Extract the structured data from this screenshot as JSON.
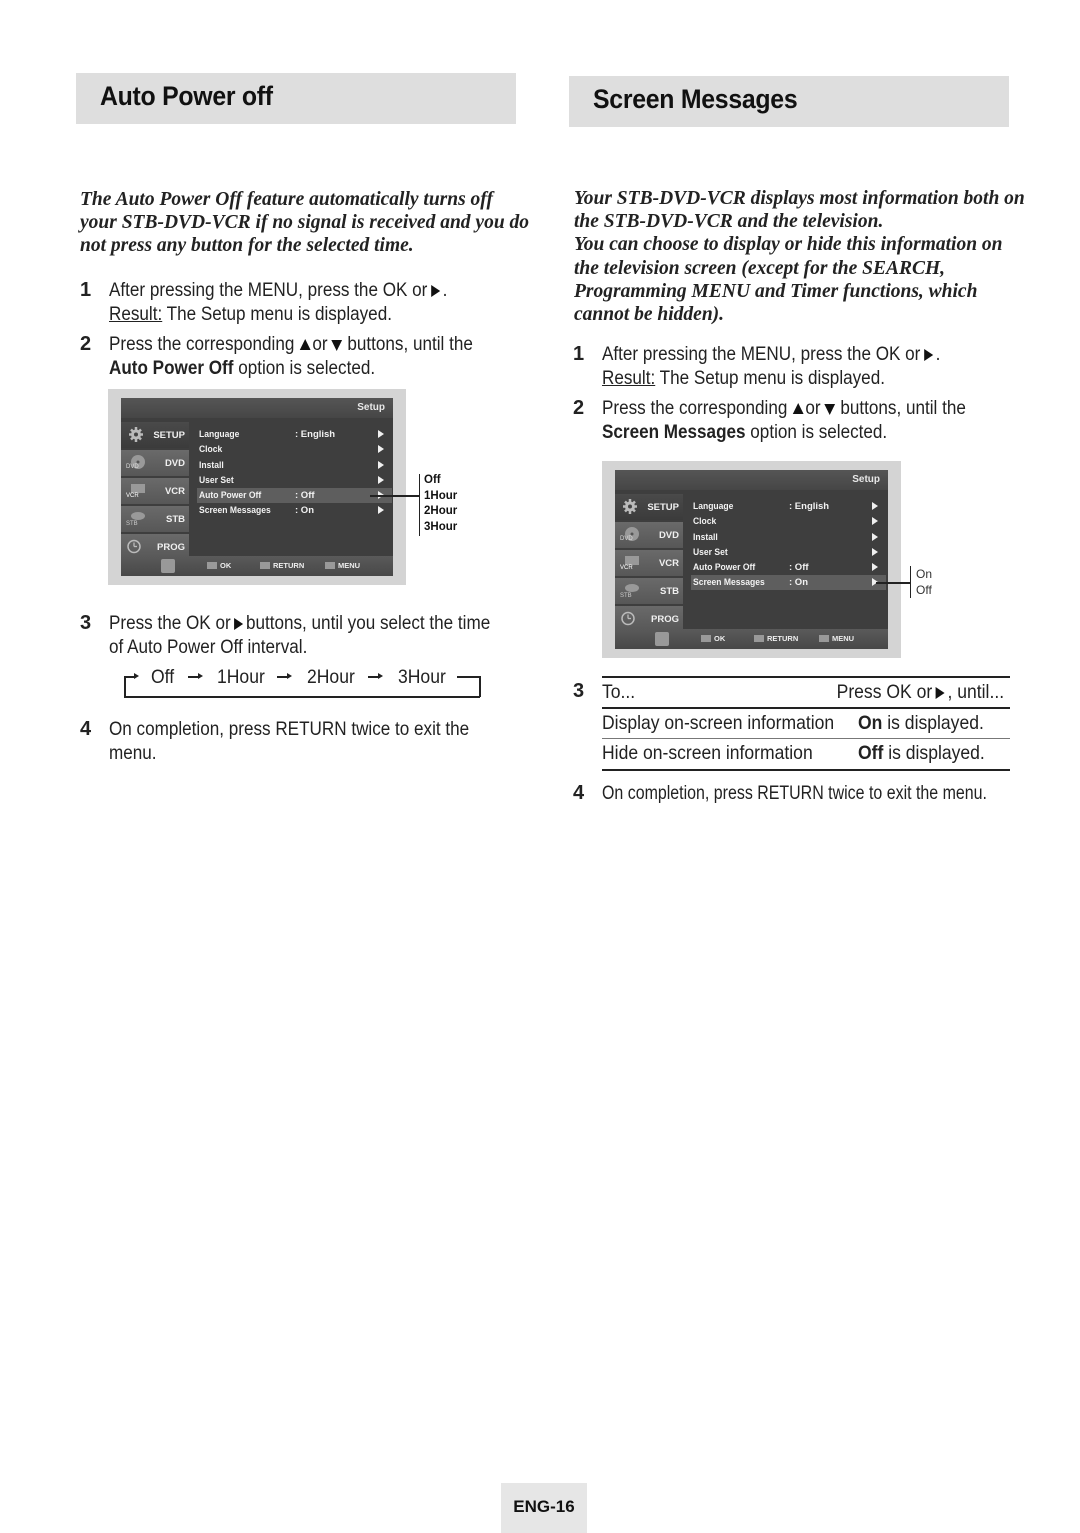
{
  "left": {
    "title": "Auto Power off",
    "intro": [
      "The Auto Power Off feature automatically turns off",
      "your STB-DVD-VCR if no signal is received and you do",
      "not press any button for the selected time."
    ],
    "steps": {
      "s1": {
        "num": "1",
        "line1": "After pressing the MENU, press the OK or",
        "line1_end": ".",
        "result_label": "Result:",
        "result_text": " The Setup menu is displayed."
      },
      "s2": {
        "num": "2",
        "line1_a": "Press the corresponding",
        "line1_or": "or",
        "line1_b": "buttons, until the",
        "bold": "Auto Power Off",
        "line2_rest": " option is selected."
      },
      "s3": {
        "num": "3",
        "line1_a": "Press the OK or",
        "line1_b": "buttons, until you select the time",
        "line2": "of Auto Power Off interval."
      },
      "s4": {
        "num": "4",
        "line1": "On completion, press RETURN twice to exit the",
        "line2": "menu."
      }
    },
    "cycle": [
      "Off",
      "1Hour",
      "2Hour",
      "3Hour"
    ],
    "osd": {
      "header": "Setup",
      "tabs": [
        "SETUP",
        "DVD",
        "VCR",
        "STB",
        "PROG"
      ],
      "rows": [
        {
          "name": "Language",
          "value": ": English"
        },
        {
          "name": "Clock",
          "value": ""
        },
        {
          "name": "Install",
          "value": ""
        },
        {
          "name": "User Set",
          "value": ""
        },
        {
          "name": "Auto Power Off",
          "value": ":  Off"
        },
        {
          "name": "Screen Messages",
          "value": ":  On"
        }
      ],
      "bottom": {
        "ok": "OK",
        "return": "RETURN",
        "menu": "MENU"
      },
      "options": [
        "Off",
        "1Hour",
        "2Hour",
        "3Hour"
      ]
    }
  },
  "right": {
    "title": "Screen Messages",
    "intro": [
      "Your STB-DVD-VCR displays most information both on",
      "the STB-DVD-VCR and the television.",
      "You can choose to display or hide this information on",
      "the television screen (except for the SEARCH,",
      "Programming MENU and Timer functions, which",
      "cannot be hidden)."
    ],
    "steps": {
      "s1": {
        "num": "1",
        "line1": "After pressing the MENU, press the OK or",
        "line1_end": ".",
        "result_label": "Result:",
        "result_text": " The Setup menu is displayed."
      },
      "s2": {
        "num": "2",
        "line1_a": "Press the corresponding",
        "line1_or": "or",
        "line1_b": "buttons, until the",
        "bold": "Screen Messages",
        "line2_rest": " option is selected."
      },
      "s3": {
        "num": "3"
      },
      "s4": {
        "num": "4",
        "line1": "On completion, press RETURN twice to exit the menu."
      }
    },
    "table": {
      "header": {
        "col1": "To...",
        "col2_a": "Press OK or",
        "col2_b": ", until..."
      },
      "rows": [
        {
          "col1": "Display on-screen information",
          "col2_bold": "On",
          "col2_rest": " is displayed."
        },
        {
          "col1": "Hide on-screen information",
          "col2_bold": "Off",
          "col2_rest": " is displayed."
        }
      ]
    },
    "osd": {
      "header": "Setup",
      "tabs": [
        "SETUP",
        "DVD",
        "VCR",
        "STB",
        "PROG"
      ],
      "rows": [
        {
          "name": "Language",
          "value": ": English"
        },
        {
          "name": "Clock",
          "value": ""
        },
        {
          "name": "Install",
          "value": ""
        },
        {
          "name": "User Set",
          "value": ""
        },
        {
          "name": "Auto Power Off",
          "value": ":  Off"
        },
        {
          "name": "Screen Messages",
          "value": ":  On"
        }
      ],
      "bottom": {
        "ok": "OK",
        "return": "RETURN",
        "menu": "MENU"
      },
      "options": [
        "On",
        "Off"
      ]
    }
  },
  "footer": {
    "page": "ENG-16"
  }
}
